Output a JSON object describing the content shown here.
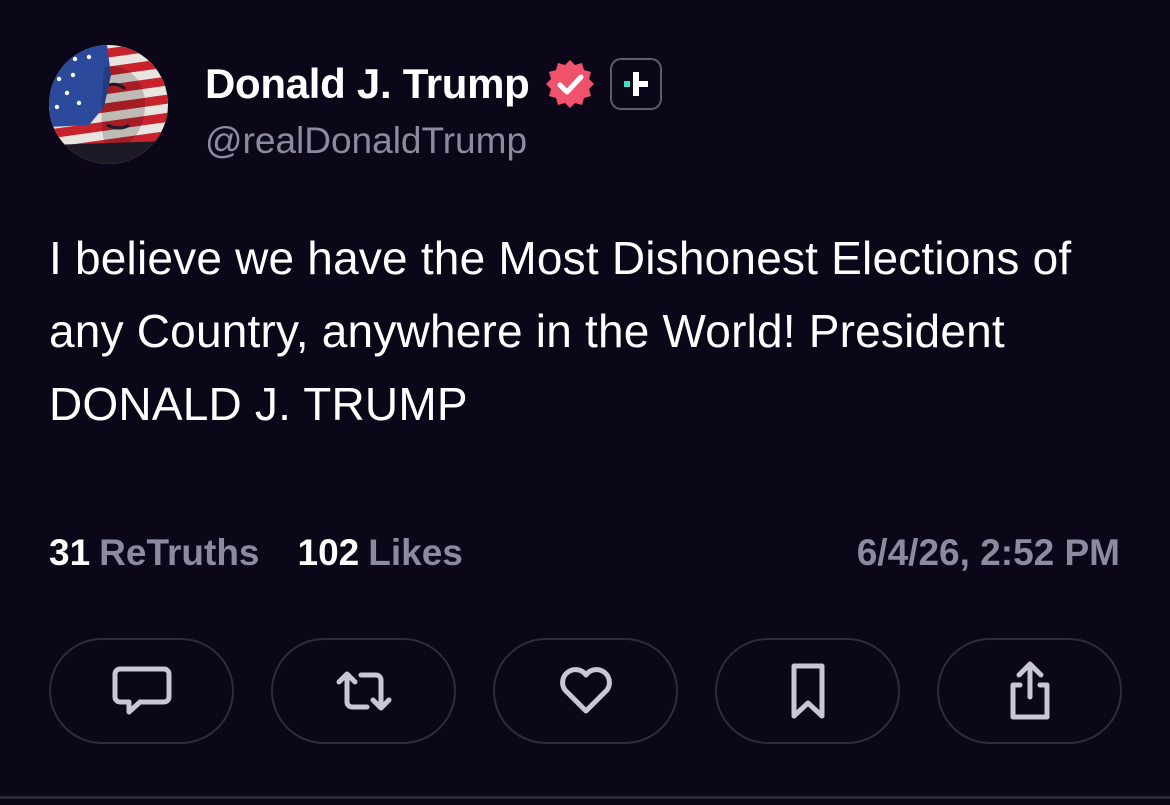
{
  "author": {
    "display_name": "Donald J. Trump",
    "handle": "@realDonaldTrump",
    "avatar_icon": "flag-face-avatar",
    "verified_icon": "verified-badge-icon",
    "plus_icon": "plus-subscription-icon"
  },
  "post": {
    "text": "I believe we have the Most Dishonest Elections of any Country, anywhere in the World! President DONALD J. TRUMP",
    "timestamp": "6/4/26, 2:52 PM"
  },
  "stats": {
    "retruths_count": "31",
    "retruths_label": "ReTruths",
    "likes_count": "102",
    "likes_label": "Likes"
  },
  "actions": [
    {
      "icon": "comment-icon"
    },
    {
      "icon": "retruth-icon"
    },
    {
      "icon": "heart-icon"
    },
    {
      "icon": "bookmark-icon"
    },
    {
      "icon": "share-icon"
    }
  ],
  "colors": {
    "background": "#0b0718",
    "text_primary": "#ffffff",
    "text_secondary": "#8c8aa0",
    "verified_badge": "#f0526b",
    "plus_accent": "#3fe0c5",
    "button_border": "#2e2a40"
  }
}
